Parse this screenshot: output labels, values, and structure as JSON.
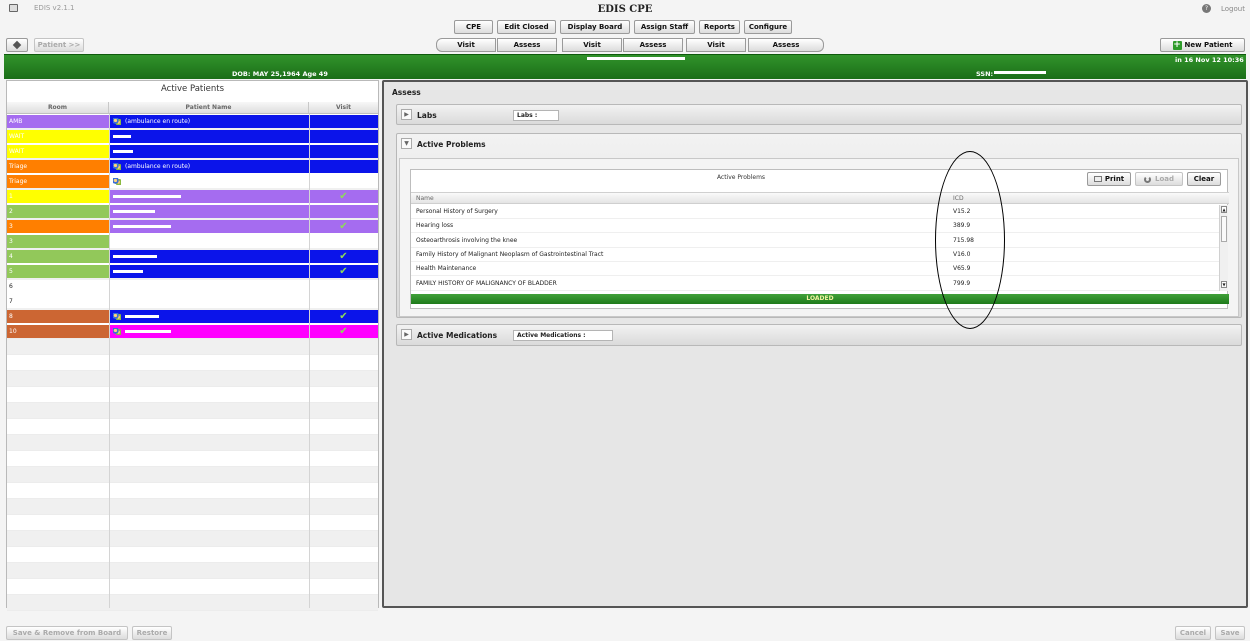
{
  "app": {
    "version": "EDIS v2.1.1",
    "title": "EDIS CPE",
    "logout": "Logout"
  },
  "menu": [
    "CPE",
    "Edit Closed",
    "Display Board",
    "Assign Staff",
    "Reports",
    "Configure"
  ],
  "tabs": [
    "Visit",
    "Assess",
    "Visit",
    "Assess",
    "Visit",
    "Assess"
  ],
  "toolbar": {
    "patient_btn": "Patient >>",
    "new_patient": "New Patient"
  },
  "patient_bar": {
    "dob": "DOB: MAY 25,1964  Age 49",
    "ssn_label": "SSN:",
    "arrival": "in 16 Nov 12 10:36"
  },
  "active_patients": {
    "title": "Active Patients",
    "headers": [
      "Room",
      "Patient Name",
      "Visit"
    ],
    "rows": [
      {
        "room": "AMB",
        "name": "(ambulance en route)",
        "room_color": "#a56cf0",
        "name_color": "#0b14ea",
        "check": false,
        "people": true,
        "redact": 0
      },
      {
        "room": "WAIT",
        "name": "",
        "room_color": "#ffff00",
        "name_color": "#0b14ea",
        "check": false,
        "people": false,
        "redact": 18
      },
      {
        "room": "WAIT",
        "name": "",
        "room_color": "#ffff00",
        "name_color": "#0b14ea",
        "check": false,
        "people": false,
        "redact": 20
      },
      {
        "room": "Triage",
        "name": "(ambulance en route)",
        "room_color": "#ff7f00",
        "name_color": "#0b14ea",
        "check": false,
        "people": true,
        "redact": 0
      },
      {
        "room": "Triage",
        "name": "",
        "room_color": "#ff7f00",
        "name_color": "#ffffff",
        "check": false,
        "people": true,
        "redact": 0
      },
      {
        "room": "1",
        "name": "",
        "room_color": "#ffff00",
        "name_color": "#a56cf0",
        "check": true,
        "people": false,
        "redact": 68
      },
      {
        "room": "2",
        "name": "",
        "room_color": "#92c85a",
        "name_color": "#a56cf0",
        "check": false,
        "people": false,
        "redact": 42
      },
      {
        "room": "3",
        "name": "",
        "room_color": "#ff7f00",
        "name_color": "#a56cf0",
        "check": true,
        "people": false,
        "redact": 58
      },
      {
        "room": "3",
        "name": "",
        "room_color": "#92c85a",
        "name_color": "#ffffff",
        "check": false,
        "people": false,
        "redact": 0
      },
      {
        "room": "4",
        "name": "",
        "room_color": "#92c85a",
        "name_color": "#0b14ea",
        "check": true,
        "people": false,
        "redact": 44
      },
      {
        "room": "5",
        "name": "",
        "room_color": "#92c85a",
        "name_color": "#0b14ea",
        "check": true,
        "people": false,
        "redact": 30
      },
      {
        "room": "6",
        "name": "",
        "room_color": "#ffffff",
        "name_color": "#ffffff",
        "check": false,
        "people": false,
        "redact": 0
      },
      {
        "room": "7",
        "name": "",
        "room_color": "#ffffff",
        "name_color": "#ffffff",
        "check": false,
        "people": false,
        "redact": 0
      },
      {
        "room": "8",
        "name": "",
        "room_color": "#cc6633",
        "name_color": "#0b14ea",
        "check": true,
        "people": true,
        "redact": 34
      },
      {
        "room": "10",
        "name": "",
        "room_color": "#cc6633",
        "name_color": "#ff00ff",
        "check": true,
        "people": true,
        "redact": 46
      }
    ]
  },
  "assess": {
    "title": "Assess",
    "labs": {
      "title": "Labs",
      "field": "Labs :"
    },
    "active_problems": {
      "title": "Active Problems",
      "table_title": "Active Problems",
      "print": "Print",
      "load": "Load",
      "clear": "Clear",
      "columns": [
        "Name",
        "ICD"
      ],
      "rows": [
        {
          "name": "Personal History of Surgery",
          "icd": "V15.2"
        },
        {
          "name": "Hearing loss",
          "icd": "389.9"
        },
        {
          "name": "Osteoarthrosis involving the knee",
          "icd": "715.98"
        },
        {
          "name": "Family History of Malignant Neoplasm of Gastrointestinal Tract",
          "icd": "V16.0"
        },
        {
          "name": "Health Maintenance",
          "icd": "V65.9"
        },
        {
          "name": "FAMILY HISTORY OF MALIGNANCY OF BLADDER",
          "icd": "799.9"
        }
      ],
      "status": "LOADED"
    },
    "medications": {
      "title": "Active Medications",
      "field": "Active Medications :"
    }
  },
  "footer": {
    "save_remove": "Save & Remove from Board",
    "restore": "Restore",
    "cancel": "Cancel",
    "save": "Save"
  },
  "colors": {
    "green": "#1f7a1c",
    "annotation": "#000000"
  }
}
